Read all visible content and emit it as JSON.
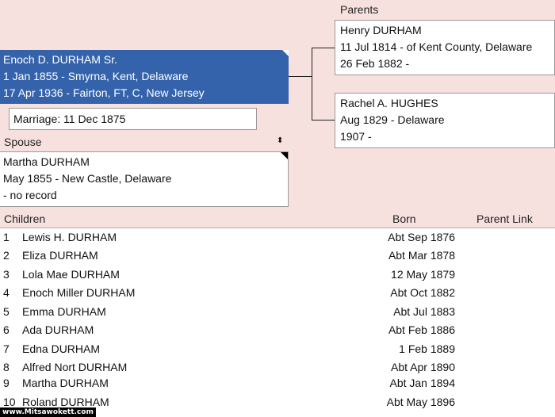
{
  "parents": {
    "label": "Parents",
    "father": {
      "name": "Henry DURHAM",
      "birth": "11 Jul 1814 - of Kent County, Delaware",
      "death": "26 Feb 1882 -"
    },
    "mother": {
      "name": "Rachel A. HUGHES",
      "birth": "Aug 1829 - Delaware",
      "death": "1907 -"
    }
  },
  "person": {
    "name": "Enoch D. DURHAM Sr.",
    "birth": "1 Jan 1855 - Smyrna, Kent, Delaware",
    "death": "17 Apr 1936 - Fairton, FT, C, New Jersey"
  },
  "marriage": {
    "text": "Marriage: 11 Dec 1875"
  },
  "spouse": {
    "label": "Spouse",
    "selector_glyph": "⬍",
    "name": "Martha DURHAM",
    "birth": "May 1855 - New Castle, Delaware",
    "death": "- no record"
  },
  "children": {
    "header": {
      "children": "Children",
      "born": "Born",
      "parent_link": "Parent Link"
    },
    "rows": [
      {
        "num": "1",
        "name": "Lewis H. DURHAM",
        "born": "Abt Sep 1876"
      },
      {
        "num": "2",
        "name": "Eliza DURHAM",
        "born": "Abt Mar 1878"
      },
      {
        "num": "3",
        "name": "Lola Mae DURHAM",
        "born": "12 May 1879"
      },
      {
        "num": "4",
        "name": "Enoch Miller DURHAM",
        "born": "Abt Oct 1882"
      },
      {
        "num": "5",
        "name": "Emma DURHAM",
        "born": "Abt Jul 1883"
      },
      {
        "num": "6",
        "name": "Ada DURHAM",
        "born": "Abt Feb 1886"
      },
      {
        "num": "7",
        "name": "Edna DURHAM",
        "born": "1 Feb 1889"
      },
      {
        "num": "8",
        "name": "Alfred Nort DURHAM",
        "born": "Abt Apr 1890"
      },
      {
        "num": "9",
        "name": "Martha DURHAM",
        "born": "Abt Jan 1894"
      },
      {
        "num": "10",
        "name": "Roland DURHAM",
        "born": "Abt May 1896"
      }
    ]
  },
  "watermark": "www.Mitsawokett.com",
  "colors": {
    "background": "#f7e1df",
    "selected": "#3563ab"
  }
}
